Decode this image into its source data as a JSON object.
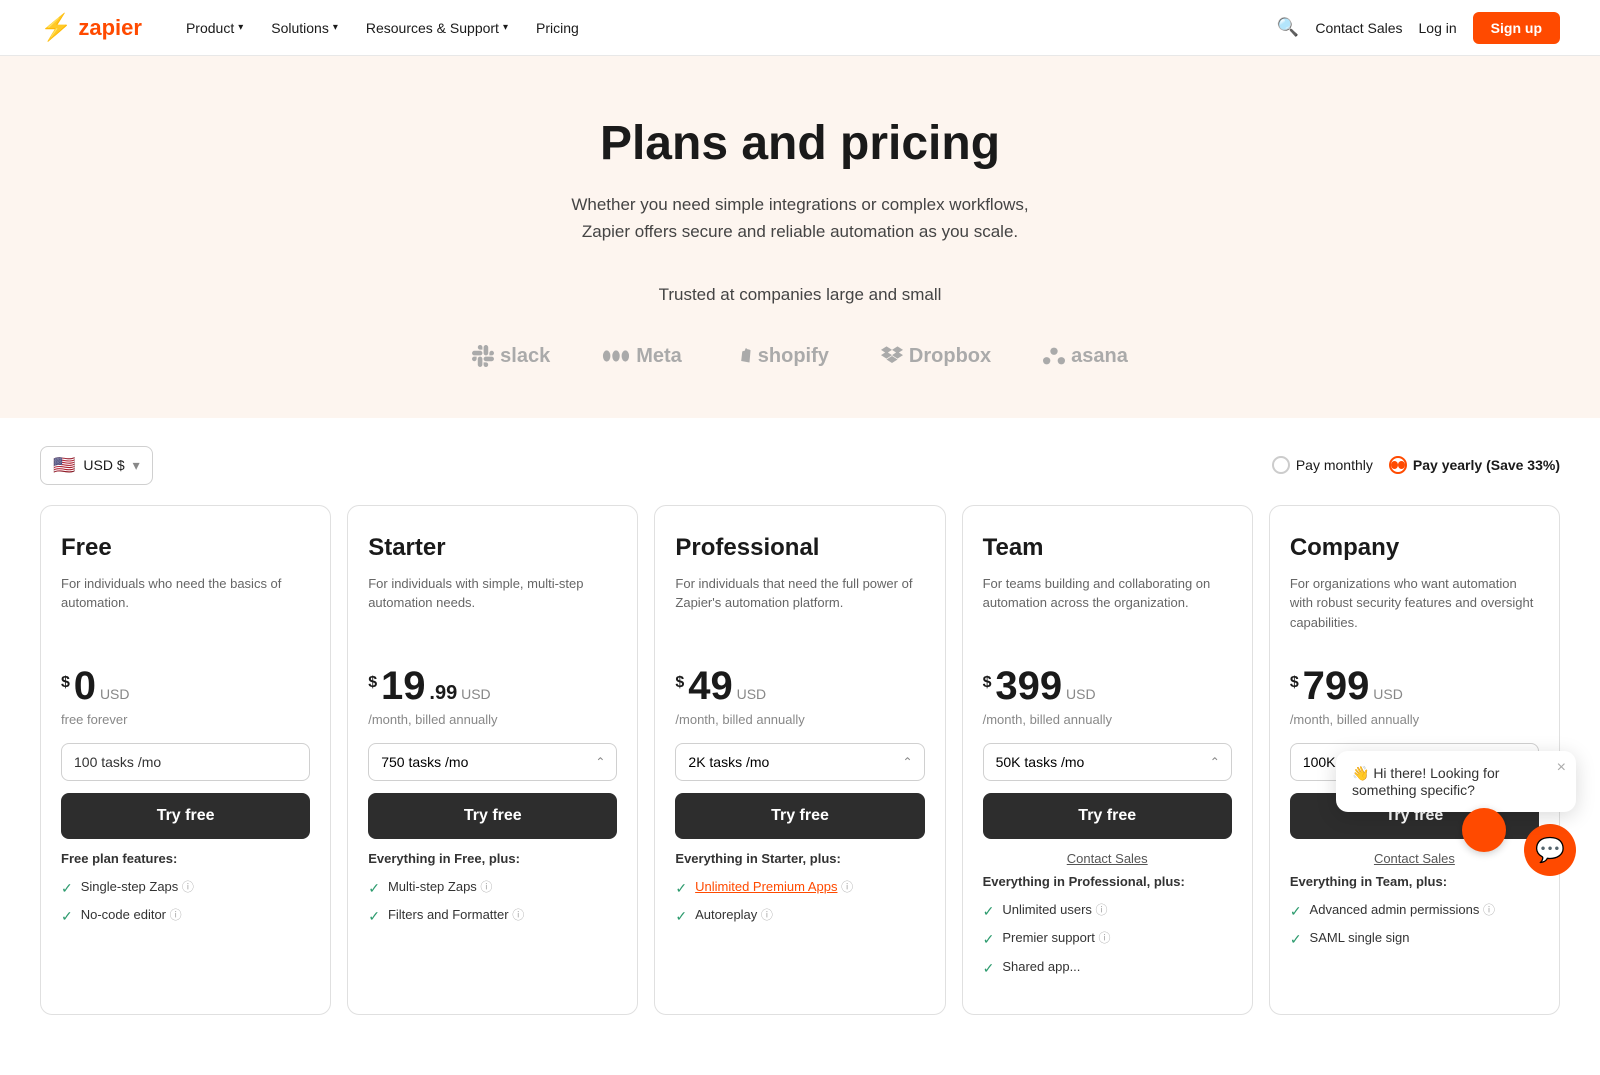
{
  "nav": {
    "logo_symbol": "⚡",
    "logo_text": "zapier",
    "links": [
      {
        "label": "Product",
        "has_dropdown": true
      },
      {
        "label": "Solutions",
        "has_dropdown": true
      },
      {
        "label": "Resources & Support",
        "has_dropdown": true
      },
      {
        "label": "Pricing",
        "has_dropdown": false
      }
    ],
    "contact_sales": "Contact Sales",
    "login": "Log in",
    "signup": "Sign up"
  },
  "hero": {
    "title": "Plans and pricing",
    "subtitle": "Whether you need simple integrations or complex workflows,\nZapier offers secure and reliable automation as you scale.",
    "trusted_text": "Trusted at companies large and small",
    "logos": [
      "slack",
      "Meta",
      "shopify",
      "Dropbox",
      "asana"
    ]
  },
  "pricing_controls": {
    "currency": "USD $",
    "pay_monthly": "Pay monthly",
    "pay_yearly": "Pay yearly (Save 33%)"
  },
  "plans": [
    {
      "id": "free",
      "name": "Free",
      "description": "For individuals who need the basics of automation.",
      "price_symbol": "$",
      "price_main": "0",
      "price_cents": "",
      "price_currency": "USD",
      "price_period": "free forever",
      "task_default": "100 tasks /mo",
      "has_task_dropdown": false,
      "try_btn": "Try free",
      "contact_link": "",
      "features_header": "Free plan features:",
      "features": [
        {
          "text": "Single-step Zaps",
          "has_info": true,
          "is_link": false
        },
        {
          "text": "No-code editor",
          "has_info": true,
          "is_link": false
        }
      ]
    },
    {
      "id": "starter",
      "name": "Starter",
      "description": "For individuals with simple, multi-step automation needs.",
      "price_symbol": "$",
      "price_main": "19",
      "price_cents": ".99",
      "price_currency": "USD",
      "price_period": "/month, billed annually",
      "task_default": "750 tasks /mo",
      "has_task_dropdown": true,
      "try_btn": "Try free",
      "contact_link": "",
      "features_header": "Everything in Free, plus:",
      "features": [
        {
          "text": "Multi-step Zaps",
          "has_info": true,
          "is_link": false
        },
        {
          "text": "Filters and Formatter",
          "has_info": true,
          "is_link": false
        }
      ]
    },
    {
      "id": "professional",
      "name": "Professional",
      "description": "For individuals that need the full power of Zapier's automation platform.",
      "price_symbol": "$",
      "price_main": "49",
      "price_cents": "",
      "price_currency": "USD",
      "price_period": "/month, billed annually",
      "task_default": "2K tasks /mo",
      "has_task_dropdown": true,
      "try_btn": "Try free",
      "contact_link": "",
      "features_header": "Everything in Starter, plus:",
      "features": [
        {
          "text": "Unlimited Premium Apps",
          "has_info": true,
          "is_link": true
        },
        {
          "text": "Autoreplay",
          "has_info": true,
          "is_link": false
        }
      ]
    },
    {
      "id": "team",
      "name": "Team",
      "description": "For teams building and collaborating on automation across the organization.",
      "price_symbol": "$",
      "price_main": "399",
      "price_cents": "",
      "price_currency": "USD",
      "price_period": "/month, billed annually",
      "task_default": "50K tasks /mo",
      "has_task_dropdown": true,
      "try_btn": "Try free",
      "contact_link": "Contact Sales",
      "features_header": "Everything in Professional, plus:",
      "features": [
        {
          "text": "Unlimited users",
          "has_info": true,
          "is_link": false
        },
        {
          "text": "Premier support",
          "has_info": true,
          "is_link": false
        },
        {
          "text": "Shared app...",
          "has_info": false,
          "is_link": false
        }
      ]
    },
    {
      "id": "company",
      "name": "Company",
      "description": "For organizations who want automation with robust security features and oversight capabilities.",
      "price_symbol": "$",
      "price_main": "799",
      "price_cents": "",
      "price_currency": "USD",
      "price_period": "/month, billed annually",
      "task_default": "100K tasks /mo",
      "has_task_dropdown": true,
      "try_btn": "Try free",
      "contact_link": "Contact Sales",
      "features_header": "Everything in Team, plus:",
      "features": [
        {
          "text": "Advanced admin permissions",
          "has_info": true,
          "is_link": false
        },
        {
          "text": "SAML single sign",
          "has_info": false,
          "is_link": false
        }
      ]
    }
  ],
  "chat": {
    "bubble_text": "👋 Hi there! Looking for something specific?",
    "icon": "💬",
    "close": "×"
  }
}
